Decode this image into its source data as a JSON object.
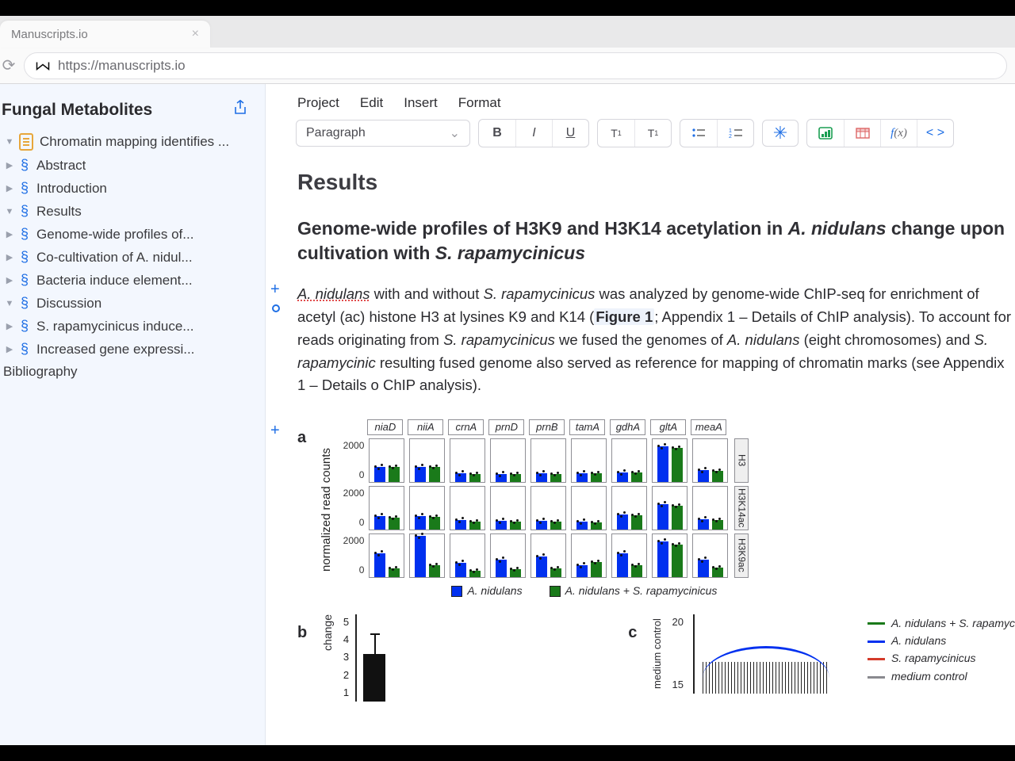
{
  "browser": {
    "tab_title": "Manuscripts.io",
    "url": "https://manuscripts.io"
  },
  "sidebar": {
    "title": "Fungal Metabolites",
    "doc_title": "Chromatin mapping identifies ...",
    "items": [
      {
        "label": "Abstract",
        "level": 1,
        "expanded": false
      },
      {
        "label": "Introduction",
        "level": 1,
        "expanded": false
      },
      {
        "label": "Results",
        "level": 1,
        "expanded": true
      },
      {
        "label": "Genome-wide profiles of...",
        "level": 2,
        "expanded": false
      },
      {
        "label": "Co-cultivation of A. nidul...",
        "level": 2,
        "expanded": false
      },
      {
        "label": "Bacteria induce element...",
        "level": 2,
        "expanded": false
      },
      {
        "label": "Discussion",
        "level": 1,
        "expanded": true
      },
      {
        "label": "S. rapamycinicus induce...",
        "level": 2,
        "expanded": false
      },
      {
        "label": "Increased gene expressi...",
        "level": 2,
        "expanded": false
      }
    ],
    "bibliography": "Bibliography"
  },
  "menubar": [
    "Project",
    "Edit",
    "Insert",
    "Format"
  ],
  "toolbar": {
    "style_select": "Paragraph"
  },
  "article": {
    "h1": "Results",
    "h2_pre": "Genome-wide profiles of H3K9 and H3K14 acetylation in ",
    "h2_it1": "A. nidulans",
    "h2_mid": " change upon cultivation with ",
    "h2_it2": "S. rapamycinicus",
    "p1_a": "A. nidulans",
    "p1_b": " with and without ",
    "p1_c": "S. rapamycinicus",
    "p1_d": " was analyzed by genome-wide ChIP-seq for enrichment of acetyl (ac) histone H3 at lysines K9 and K14 (",
    "p1_fig": "Figure 1",
    "p1_e": "; Appendix 1 – Details of ChIP analysis). To account for reads originating from ",
    "p1_f": "S. rapamycinicus",
    "p1_g": " we fused the genomes of ",
    "p1_h": "A. nidulans",
    "p1_i": " (eight chromosomes) and ",
    "p1_j": "S. rapamycinic",
    "p1_k": " resulting fused genome also served as reference for mapping of chromatin marks (see Appendix 1 – Details o ChIP analysis)."
  },
  "figure": {
    "panel_a_label": "a",
    "panel_b_label": "b",
    "panel_c_label": "c",
    "ylabel_a": "normalized read counts",
    "ylabel_b": "change",
    "ylabel_c": "medium control",
    "genes": [
      "niaD",
      "niiA",
      "crnA",
      "prnD",
      "prnB",
      "tamA",
      "gdhA",
      "gltA",
      "meaA"
    ],
    "row_labels": [
      "H3",
      "H3K14ac",
      "H3K9ac"
    ],
    "yticks_a": [
      "2000",
      "0"
    ],
    "legend_a": [
      "A. nidulans",
      "A. nidulans + S. rapamycinicus"
    ],
    "yticks_b": [
      "5",
      "4",
      "3",
      "2",
      "1"
    ],
    "yticks_c": [
      "20",
      "15"
    ],
    "legend_c": [
      "A. nidulans + S. rapamyc",
      "A. nidulans",
      "S. rapamycinicus",
      "medium control"
    ]
  },
  "chart_data": {
    "type": "bar",
    "title": "",
    "panel": "a",
    "ylabel": "normalized read counts",
    "ylim": [
      0,
      2500
    ],
    "categories": [
      "niaD",
      "niiA",
      "crnA",
      "prnD",
      "prnB",
      "tamA",
      "gdhA",
      "gltA",
      "meaA"
    ],
    "facets_row": [
      "H3",
      "H3K14ac",
      "H3K9ac"
    ],
    "series_names": [
      "A. nidulans",
      "A. nidulans + S. rapamycinicus"
    ],
    "data": {
      "H3": {
        "A. nidulans": [
          900,
          900,
          500,
          450,
          500,
          500,
          550,
          2100,
          700
        ],
        "A. nidulans + S. rapamycinicus": [
          900,
          900,
          450,
          450,
          450,
          500,
          550,
          2000,
          650
        ]
      },
      "H3K14ac": {
        "A. nidulans": [
          800,
          800,
          550,
          500,
          500,
          450,
          900,
          1500,
          600
        ],
        "A. nidulans + S. rapamycinicus": [
          700,
          750,
          450,
          450,
          450,
          400,
          850,
          1400,
          550
        ]
      },
      "H3K9ac": {
        "A. nidulans": [
          1400,
          2400,
          850,
          1000,
          1200,
          700,
          1400,
          2100,
          1000
        ],
        "A. nidulans + S. rapamycinicus": [
          500,
          700,
          350,
          450,
          500,
          900,
          700,
          1900,
          550
        ]
      }
    },
    "panel_b": {
      "type": "bar",
      "ylabel": "change",
      "yticks": [
        1,
        2,
        3,
        4,
        5
      ],
      "values": [
        2.8
      ],
      "error": [
        1.1
      ]
    },
    "panel_c": {
      "type": "line",
      "ylabel": "medium control",
      "yticks": [
        15,
        20
      ],
      "series": [
        {
          "name": "A. nidulans + S. rapamycinicus",
          "color": "#1a7a1a"
        },
        {
          "name": "A. nidulans",
          "color": "#0030ef"
        },
        {
          "name": "S. rapamycinicus",
          "color": "#d43b2a"
        },
        {
          "name": "medium control",
          "color": "#8a8a8f"
        }
      ]
    }
  }
}
